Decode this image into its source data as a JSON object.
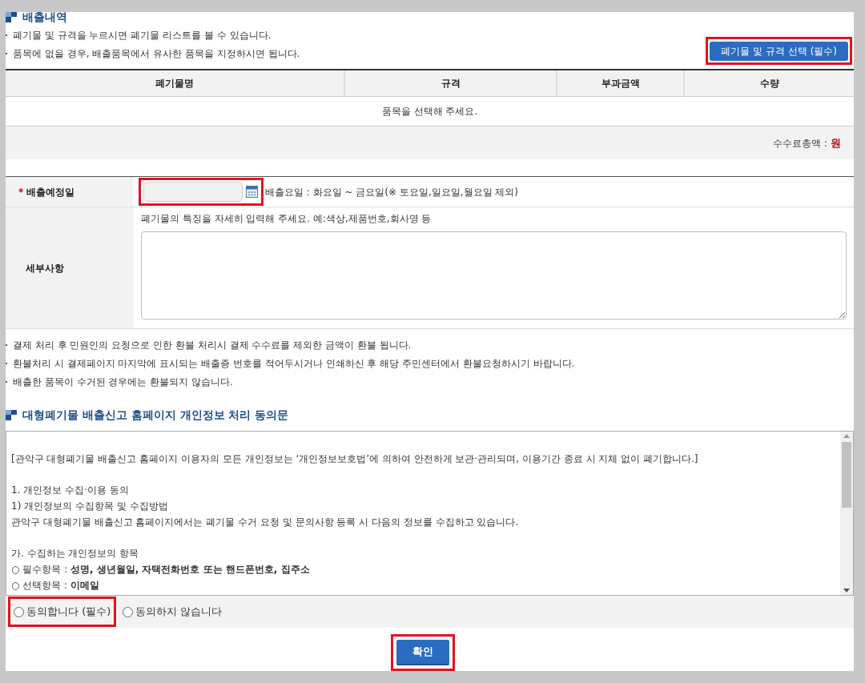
{
  "emission": {
    "title": "배출내역",
    "notes": [
      "폐기물 및 규격을 누르시면 폐기물 리스트를 볼 수 있습니다.",
      "품목에 없을 경우, 배출품목에서 유사한 품목을 지정하시면 됩니다."
    ],
    "select_button": "폐기물 및 규격 선택 (필수)",
    "table": {
      "columns": [
        "폐기물명",
        "규격",
        "부과금액",
        "수량"
      ],
      "empty_message": "품목을 선택해 주세요."
    },
    "total": {
      "label": "수수료총액 :",
      "value": "원"
    }
  },
  "form": {
    "date": {
      "required_mark": "*",
      "label": "배출예정일",
      "hint": "배출요일 : 화요일 ~ 금요일(※ 토요일,일요일,월요일 제외)"
    },
    "details": {
      "label": "세부사항",
      "hint": "폐기물의 특징을 자세히 입력해 주세요. 예:색상,제품번호,회사명 등"
    }
  },
  "refund_notes": [
    "결제 처리 후 민원인의 요청으로 인한 환불 처리시 결제 수수료를 제외한 금액이 환불 됩니다.",
    "환불처리 시 결제페이지 마지막에 표시되는 배출증 번호를 적어두시거나 인쇄하신 후 해당 주민센터에서 환불요청하시기 바랍니다.",
    "배출한 품목이 수거된 경우에는 환불되지 않습니다."
  ],
  "privacy": {
    "title": "대형폐기물 배출신고 홈페이지 개인정보 처리 동의문",
    "paragraphs": [
      {
        "lines": [
          "[관악구 대형폐기물 배출신고 홈페이지 이용자의 모든 개인정보는 ‘개인정보보호법’에 의하여 안전하게 보관·관리되며, 이용기간 종료 시 지체 없이 폐기합니다.]"
        ]
      },
      {
        "lines": [
          "1. 개인정보 수집·이용 동의",
          "1) 개인정보의 수집항목 및 수집방법",
          "관악구 대형폐기물 배출신고 홈페이지에서는 폐기물 수거 요청 및 문의사항 등록 시 다음의 정보를 수집하고 있습니다."
        ]
      },
      {
        "lines": [
          "가. 수집하는 개인정보의 항목",
          "○ 필수항목 : **성명, 생년월일, 자택전화번호 또는 핸드폰번호, 집주소**",
          "○ 선택항목 : **이메일**"
        ]
      }
    ],
    "consent": [
      {
        "label": "동의합니다 (필수)",
        "selected": false,
        "highlighted": true
      },
      {
        "label": "동의하지 않습니다",
        "selected": false,
        "highlighted": false
      }
    ]
  },
  "confirm_button": "확인"
}
